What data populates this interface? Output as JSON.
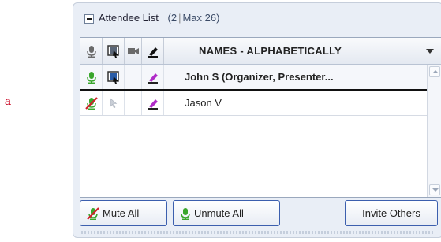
{
  "callout": {
    "label": "a"
  },
  "panel": {
    "title": "Attendee List",
    "count_open": "(2",
    "count_sep": "|",
    "count_max": "Max 26)"
  },
  "columns": {
    "names_header": "NAMES - ALPHABETICALLY",
    "icons": [
      "microphone-icon",
      "screen-icon",
      "webcam-icon",
      "annotation-pen-icon"
    ]
  },
  "attendees": [
    {
      "name": "John S (Organizer, Presenter...",
      "mic_status": "unmuted",
      "bold": true
    },
    {
      "name": "Jason V",
      "mic_status": "muted",
      "bold": false
    }
  ],
  "buttons": {
    "mute_all": "Mute All",
    "unmute_all": "Unmute All",
    "invite_others": "Invite Others"
  },
  "colors": {
    "mic_green": "#3aa62c",
    "mute_red": "#d0202a",
    "pen_purple": "#b02cc8",
    "button_border": "#3c5fae"
  }
}
